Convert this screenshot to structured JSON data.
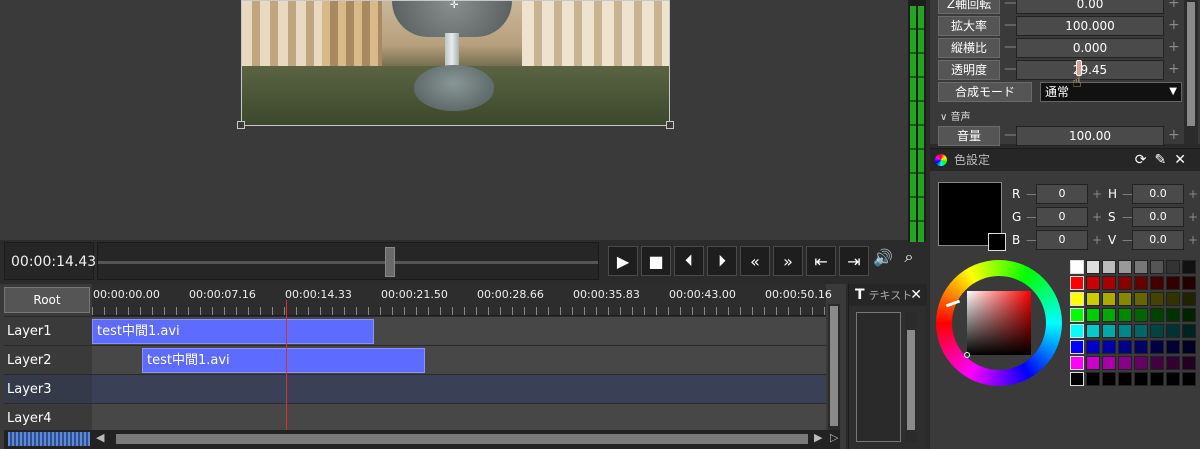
{
  "preview": {
    "timecode": "00:00:14.43"
  },
  "timeline": {
    "root_label": "Root",
    "ruler": [
      "00:00:00.00",
      "00:00:07.16",
      "00:00:14.33",
      "00:00:21.50",
      "00:00:28.66",
      "00:00:35.83",
      "00:00:43.00",
      "00:00:50.16"
    ],
    "layers": [
      {
        "label": "Layer1"
      },
      {
        "label": "Layer2"
      },
      {
        "label": "Layer3"
      },
      {
        "label": "Layer4"
      }
    ],
    "clips": [
      {
        "name": "test中間1.avi",
        "layer": "Layer1"
      },
      {
        "name": "test中間1.avi",
        "layer": "Layer2"
      }
    ]
  },
  "text_panel": {
    "title": "テキスト"
  },
  "properties": {
    "rows": [
      {
        "label": "Z軸回転",
        "value": "0.00"
      },
      {
        "label": "拡大率",
        "value": "100.000"
      },
      {
        "label": "縦横比",
        "value": "0.000"
      },
      {
        "label": "透明度",
        "value": "29.45"
      }
    ],
    "blend_label": "合成モード",
    "blend_value": "通常",
    "section_audio": "音声",
    "volume_label": "音量",
    "volume_value": "100.00"
  },
  "color_panel": {
    "title": "色設定",
    "fields": [
      {
        "label": "R",
        "value": "0"
      },
      {
        "label": "G",
        "value": "0"
      },
      {
        "label": "B",
        "value": "0"
      },
      {
        "label": "H",
        "value": "0.0"
      },
      {
        "label": "S",
        "value": "0.0"
      },
      {
        "label": "V",
        "value": "0.0"
      }
    ],
    "colors": {
      "clip": "#5e6bff",
      "playhead": "#d23333",
      "meter": "#22a622"
    }
  }
}
